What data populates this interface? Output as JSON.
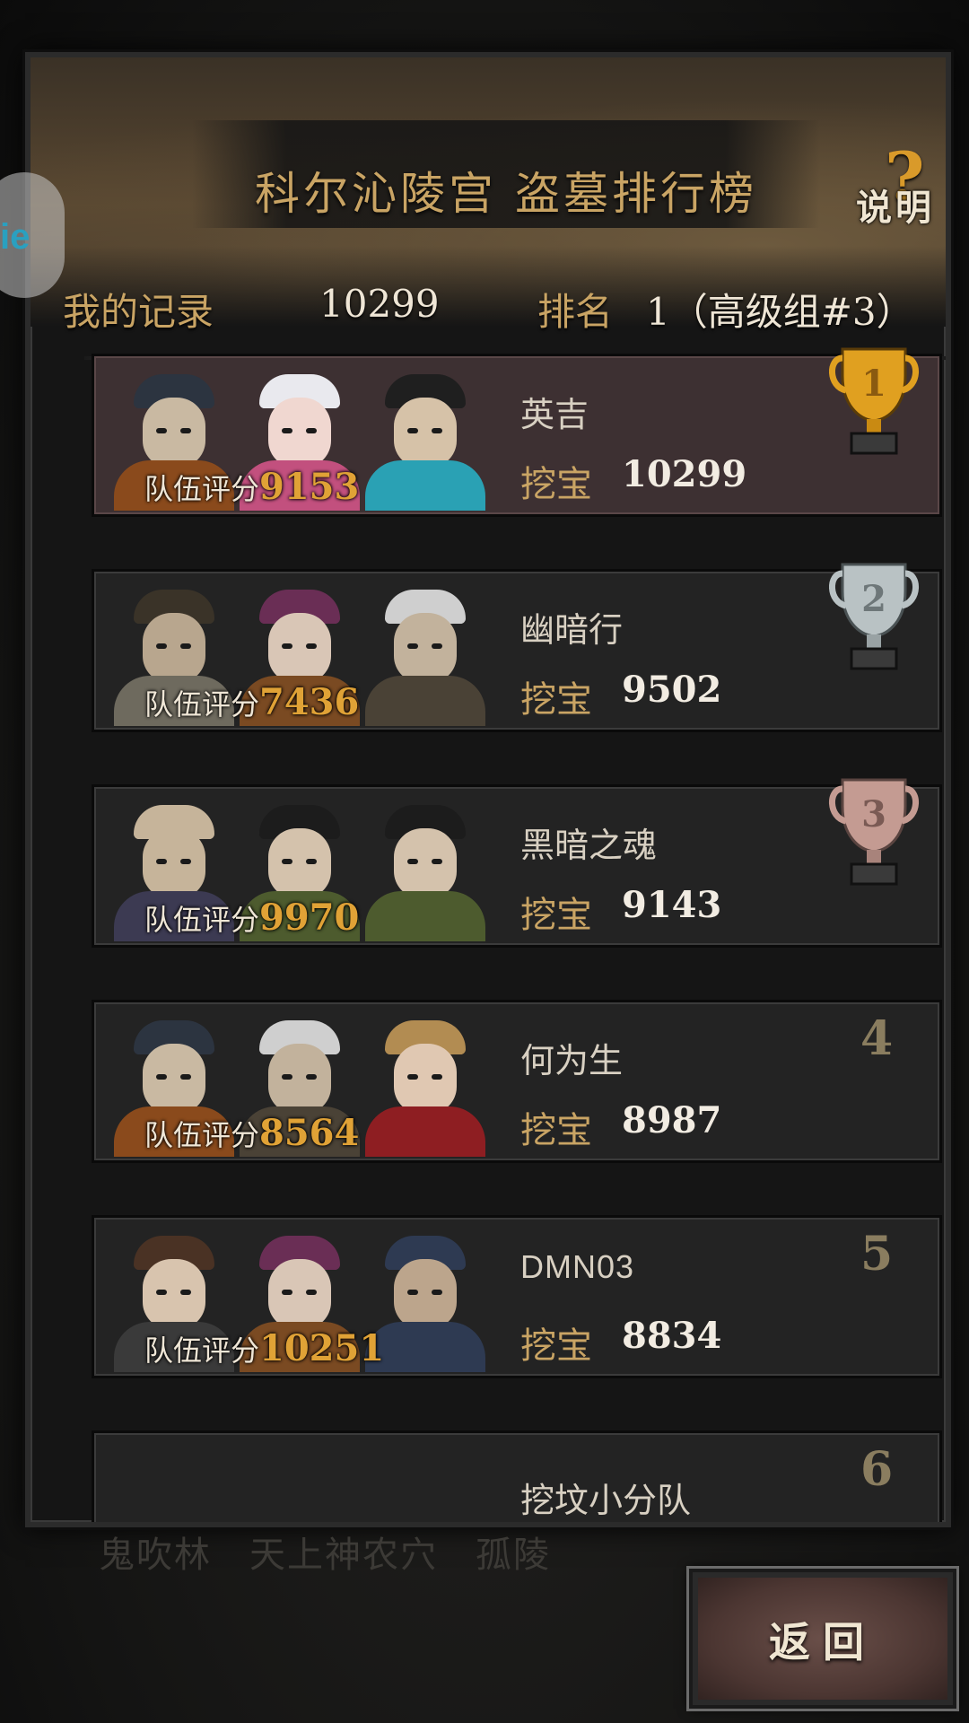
{
  "header": {
    "title": "科尔沁陵宫 盗墓排行榜",
    "help_label": "说明",
    "help_glyph": "?"
  },
  "side_bubble": {
    "text": "ie"
  },
  "my_record": {
    "label": "我的记录",
    "score": "10299",
    "rank_label": "排名",
    "rank_value": "1（高级组#3）"
  },
  "labels": {
    "team_score": "队伍评分",
    "dig": "挖宝"
  },
  "leaderboard": [
    {
      "rank": "1",
      "name": "英吉",
      "team_score": "9153",
      "dig_score": "10299",
      "trophy": "gold"
    },
    {
      "rank": "2",
      "name": "幽暗行",
      "team_score": "7436",
      "dig_score": "9502",
      "trophy": "silver"
    },
    {
      "rank": "3",
      "name": "黑暗之魂",
      "team_score": "9970",
      "dig_score": "9143",
      "trophy": "bronze"
    },
    {
      "rank": "4",
      "name": "何为生",
      "team_score": "8564",
      "dig_score": "8987"
    },
    {
      "rank": "5",
      "name": "DMN03",
      "team_score": "10251",
      "dig_score": "8834"
    },
    {
      "rank": "6",
      "name": "挖坟小分队"
    }
  ],
  "background_tabs": "鬼吹林　天上神农穴　孤陵",
  "back_button": {
    "label": "返回"
  },
  "colors": {
    "gold_text": "#c9a464",
    "score_orange": "#e0a236",
    "trophy_gold": "#e0a020",
    "trophy_silver": "#b9c2c4",
    "trophy_bronze": "#c49b92"
  }
}
